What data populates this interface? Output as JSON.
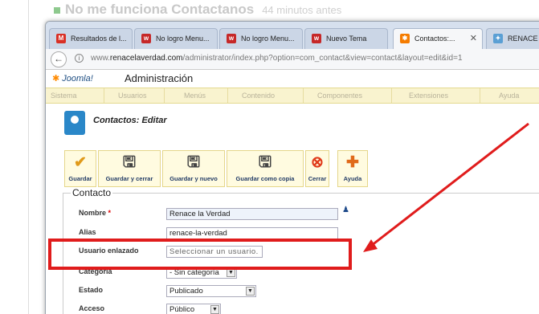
{
  "forum": {
    "post_title": "No me funciona Contactanos",
    "post_time": "44 minutos antes"
  },
  "tabs": [
    {
      "label": "Resultados de l...",
      "icon": "gmail-icon",
      "color": "#d93025"
    },
    {
      "label": "No logro Menu...",
      "icon": "site-icon",
      "color": "#c62828"
    },
    {
      "label": "No logro Menu...",
      "icon": "site-icon",
      "color": "#c62828"
    },
    {
      "label": "Nuevo Tema",
      "icon": "site-icon",
      "color": "#c62828"
    },
    {
      "label": "Contactos:...",
      "icon": "joomla-icon",
      "color": "#f57c00",
      "active": true,
      "close": "✕"
    },
    {
      "label": "RENACE LA",
      "icon": "site-icon",
      "color": "#5a9fd4"
    }
  ],
  "address": {
    "prefix": "www.",
    "domain": "renacelaverdad.com",
    "path": "/administrator/index.php?option=com_contact&view=contact&layout=edit&id=1"
  },
  "joomla": {
    "logo": "Joomla!",
    "admin_title": "Administración",
    "menu": [
      "Sistema",
      "Usuarios",
      "Menús",
      "Contenido",
      "Componentes",
      "Extensiones",
      "Ayuda"
    ],
    "page_title": "Contactos: Editar"
  },
  "toolbar": [
    {
      "label": "Guardar",
      "icon": "check-icon",
      "color": "#e09a1a"
    },
    {
      "label": "Guardar y cerrar",
      "icon": "save-icon",
      "color": "#444"
    },
    {
      "label": "Guardar y nuevo",
      "icon": "save-new-icon",
      "color": "#444"
    },
    {
      "label": "Guardar como copia",
      "icon": "save-copy-icon",
      "color": "#444"
    },
    {
      "label": "Cerrar",
      "icon": "close-icon",
      "color": "#e03a1a"
    },
    {
      "label": "Ayuda",
      "icon": "help-icon",
      "color": "#e06a1a"
    }
  ],
  "form": {
    "legend": "Contacto",
    "name_label": "Nombre",
    "name_required": "*",
    "name_value": "Renace la Verdad",
    "alias_label": "Alias",
    "alias_value": "renace-la-verdad",
    "user_label": "Usuario enlazado",
    "user_placeholder": "Seleccionar un usuario.",
    "category_label": "Categoría",
    "category_value": "- Sin categoría",
    "state_label": "Estado",
    "state_value": "Publicado",
    "access_label": "Acceso",
    "access_value": "Público"
  },
  "colors": {
    "annotation": "#e01c1c",
    "menubar": "#f9f3cf"
  }
}
